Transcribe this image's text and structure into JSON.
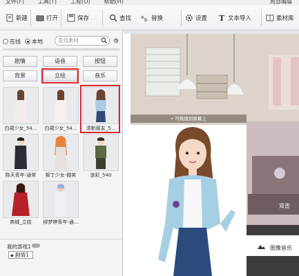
{
  "menubar": {
    "items": [
      "文件(F)",
      "工具(T)",
      "工程(O)",
      "帮助(H)"
    ],
    "right": "局部编辑"
  },
  "toolbar": {
    "new_label": "新建",
    "open_label": "打开",
    "save_label": "保存",
    "find_label": "查找",
    "replace_label": "替换",
    "settings_label": "设置",
    "import_text_label": "文本导入",
    "library_label": "素材库"
  },
  "left_panel": {
    "source_online": "在线",
    "source_local": "本地",
    "search_placeholder": "查找素材",
    "categories": [
      {
        "label": "剧情"
      },
      {
        "label": "语音"
      },
      {
        "label": "按钮"
      },
      {
        "label": "背景"
      },
      {
        "label": "立绘"
      },
      {
        "label": "音乐"
      }
    ],
    "selected_category": "立绘",
    "assets": [
      {
        "caption": "白裙少女_54..."
      },
      {
        "caption": "白裙少女_54..."
      },
      {
        "caption": "清新朋友_5..."
      },
      {
        "caption": "陈天青年-通常"
      },
      {
        "caption": "柳丁少女-微笑"
      },
      {
        "caption": "迷彩_540"
      },
      {
        "caption": "商城_立绘"
      },
      {
        "caption": "缪梦婷青年-通..."
      }
    ],
    "game_label": "我的游戏1",
    "chapter_label": "剧情1"
  },
  "stage": {
    "scene_caption": "• 可拖拽到屏幕上",
    "double_click_hint": "双击",
    "music_label": "图像音乐"
  },
  "colors": {
    "highlight_red": "#d9252b",
    "toolbar_bg": "#eef0f3",
    "panel_bg": "#f3f4f6"
  }
}
